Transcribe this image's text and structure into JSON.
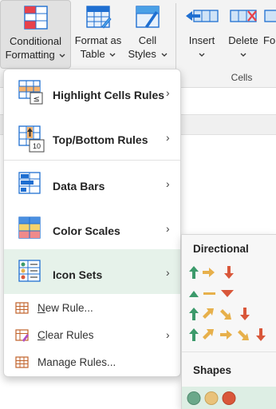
{
  "ribbon": {
    "conditional_formatting": {
      "line1": "Conditional",
      "line2": "Formatting"
    },
    "format_as_table": {
      "line1": "Format as",
      "line2": "Table"
    },
    "cell_styles": {
      "line1": "Cell",
      "line2": "Styles"
    },
    "insert": "Insert",
    "delete": "Delete",
    "format_partial": "Fo",
    "group_cells": "Cells"
  },
  "menu": {
    "items": [
      {
        "label": "Highlight Cells Rules"
      },
      {
        "label": "Top/Bottom Rules"
      },
      {
        "label": "Data Bars"
      },
      {
        "label": "Color Scales"
      },
      {
        "label": "Icon Sets"
      }
    ],
    "commands": [
      {
        "label_ul": "N",
        "label_rest": "ew Rule..."
      },
      {
        "label_ul": "C",
        "label_rest": "lear Rules"
      },
      {
        "label_ul": "",
        "label_rest": "Manage Rules..."
      }
    ],
    "top_bottom_icon_text": "10"
  },
  "icon_sets": {
    "directional_heading": "Directional",
    "shapes_heading": "Shapes"
  },
  "colors": {
    "accent_green": "#217346",
    "icon_green": "#3c9a6b",
    "icon_yellow": "#e7b04b",
    "icon_red": "#d9573a",
    "highlight": "#e6f2ea"
  },
  "icons": [
    "conditional-formatting-icon",
    "format-as-table-icon",
    "cell-styles-icon",
    "insert-cells-icon",
    "delete-cells-icon",
    "highlight-cells-icon",
    "top-bottom-icon",
    "data-bars-icon",
    "color-scales-icon",
    "icon-sets-icon",
    "new-rule-icon",
    "clear-rules-icon",
    "manage-rules-icon",
    "chevron-right-icon",
    "chevron-down-icon"
  ]
}
